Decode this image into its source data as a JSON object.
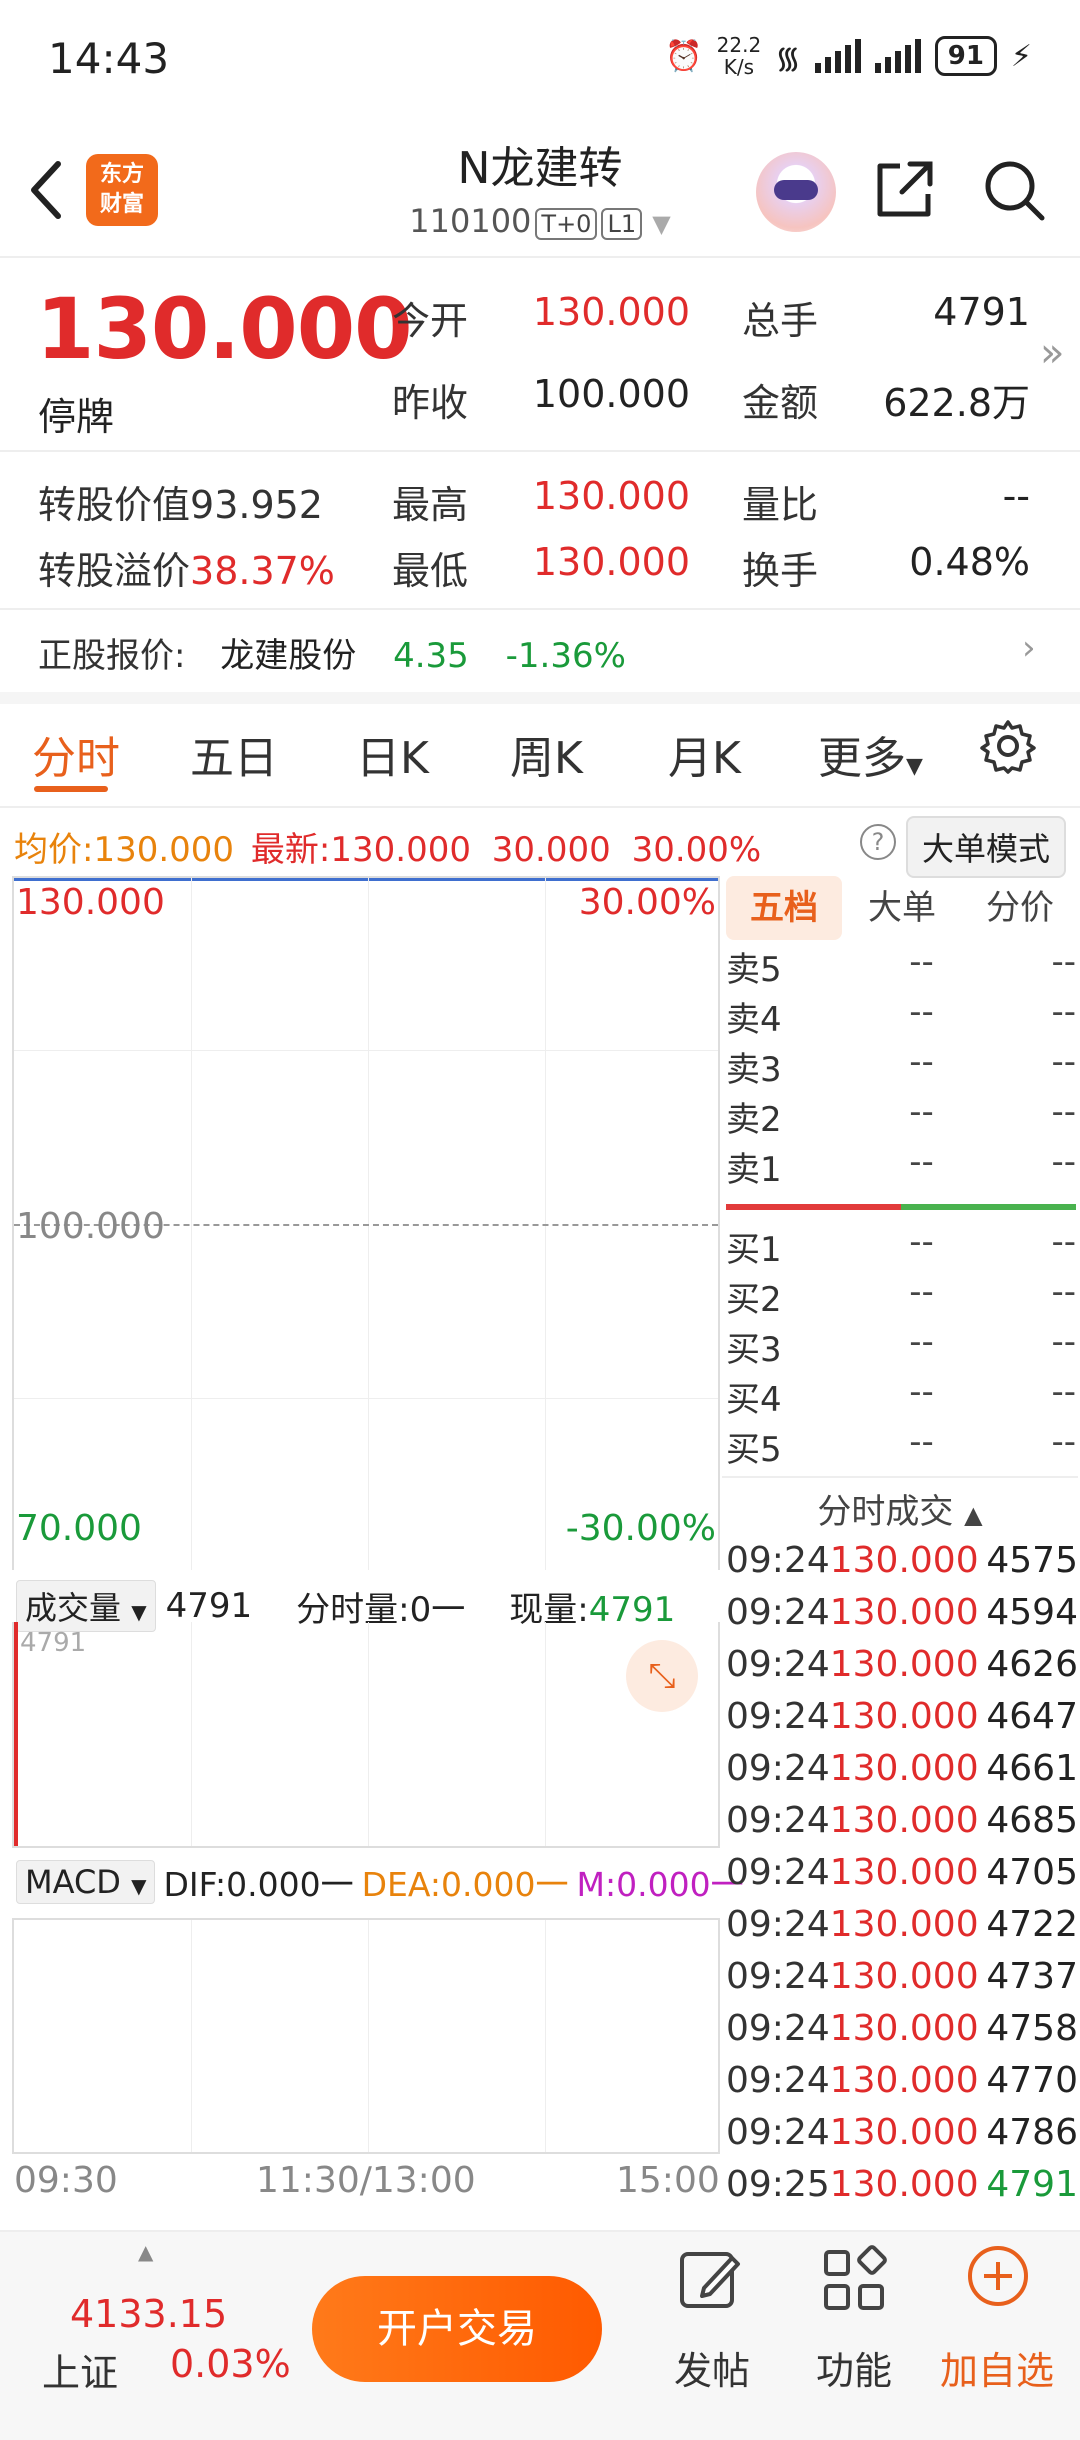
{
  "status": {
    "time": "14:43",
    "netspeed_top": "22.2",
    "netspeed_unit": "K/s",
    "wifi_tag": "6",
    "battery": "91"
  },
  "header": {
    "title": "N龙建转",
    "code": "110100",
    "tag1": "T+0",
    "tag2": "L1",
    "logo_line1": "东方",
    "logo_line2": "财富"
  },
  "quote": {
    "price": "130.000",
    "state": "停牌",
    "open_label": "今开",
    "open": "130.000",
    "prev_label": "昨收",
    "prev": "100.000",
    "vol_label": "总手",
    "vol": "4791",
    "amt_label": "金额",
    "amt": "622.8万",
    "conv_value_label": "转股价值",
    "conv_value": "93.952",
    "premium_label": "转股溢价",
    "premium": "38.37%",
    "high_label": "最高",
    "high": "130.000",
    "low_label": "最低",
    "low": "130.000",
    "ratio_label": "量比",
    "ratio": "--",
    "turnover_label": "换手",
    "turnover": "0.48%"
  },
  "stock": {
    "label": "正股报价:",
    "name": "龙建股份",
    "price": "4.35",
    "change": "-1.36%"
  },
  "tabs": [
    "分时",
    "五日",
    "日K",
    "周K",
    "月K",
    "更多"
  ],
  "info": {
    "avg_label": "均价:",
    "avg": "130.000",
    "latest_label": "最新:",
    "latest": "130.000",
    "chg": "30.000",
    "pct": "30.00%",
    "mode_button": "大单模式",
    "help": "?"
  },
  "chart": {
    "top_left": "130.000",
    "top_right": "30.00%",
    "mid": "100.000",
    "bottom_left": "70.000",
    "bottom_right": "-30.00%",
    "time_start": "09:30",
    "time_mid": "11:30/13:00",
    "time_end": "15:00"
  },
  "volume": {
    "selector": "成交量",
    "total": "4791",
    "per_min_label": "分时量:",
    "per_min": "0",
    "now_label": "现量:",
    "now": "4791",
    "axis_max": "4791"
  },
  "macd": {
    "selector": "MACD",
    "dif": "DIF:0.000",
    "dea": "DEA:0.000",
    "m": "M:0.000"
  },
  "orderbook": {
    "tabs": [
      "五档",
      "大单",
      "分价"
    ],
    "sells": [
      {
        "label": "卖5",
        "price": "--",
        "vol": "--"
      },
      {
        "label": "卖4",
        "price": "--",
        "vol": "--"
      },
      {
        "label": "卖3",
        "price": "--",
        "vol": "--"
      },
      {
        "label": "卖2",
        "price": "--",
        "vol": "--"
      },
      {
        "label": "卖1",
        "price": "--",
        "vol": "--"
      }
    ],
    "buys": [
      {
        "label": "买1",
        "price": "--",
        "vol": "--"
      },
      {
        "label": "买2",
        "price": "--",
        "vol": "--"
      },
      {
        "label": "买3",
        "price": "--",
        "vol": "--"
      },
      {
        "label": "买4",
        "price": "--",
        "vol": "--"
      },
      {
        "label": "买5",
        "price": "--",
        "vol": "--"
      }
    ]
  },
  "trades": {
    "header": "分时成交",
    "rows": [
      {
        "t": "09:24",
        "p": "130.000",
        "v": "4575"
      },
      {
        "t": "09:24",
        "p": "130.000",
        "v": "4594"
      },
      {
        "t": "09:24",
        "p": "130.000",
        "v": "4626"
      },
      {
        "t": "09:24",
        "p": "130.000",
        "v": "4647"
      },
      {
        "t": "09:24",
        "p": "130.000",
        "v": "4661"
      },
      {
        "t": "09:24",
        "p": "130.000",
        "v": "4685"
      },
      {
        "t": "09:24",
        "p": "130.000",
        "v": "4705"
      },
      {
        "t": "09:24",
        "p": "130.000",
        "v": "4722"
      },
      {
        "t": "09:24",
        "p": "130.000",
        "v": "4737"
      },
      {
        "t": "09:24",
        "p": "130.000",
        "v": "4758"
      },
      {
        "t": "09:24",
        "p": "130.000",
        "v": "4770"
      },
      {
        "t": "09:24",
        "p": "130.000",
        "v": "4786"
      },
      {
        "t": "09:25",
        "p": "130.000",
        "v": "4791"
      }
    ]
  },
  "bottom": {
    "index_value": "4133.15",
    "index_name": "上证",
    "index_pct": "0.03%",
    "open_button": "开户交易",
    "post": "发帖",
    "func": "功能",
    "add": "加自选"
  },
  "colors": {
    "up": "#e02b2b",
    "down": "#1a9a3a",
    "accent": "#e8601c"
  }
}
